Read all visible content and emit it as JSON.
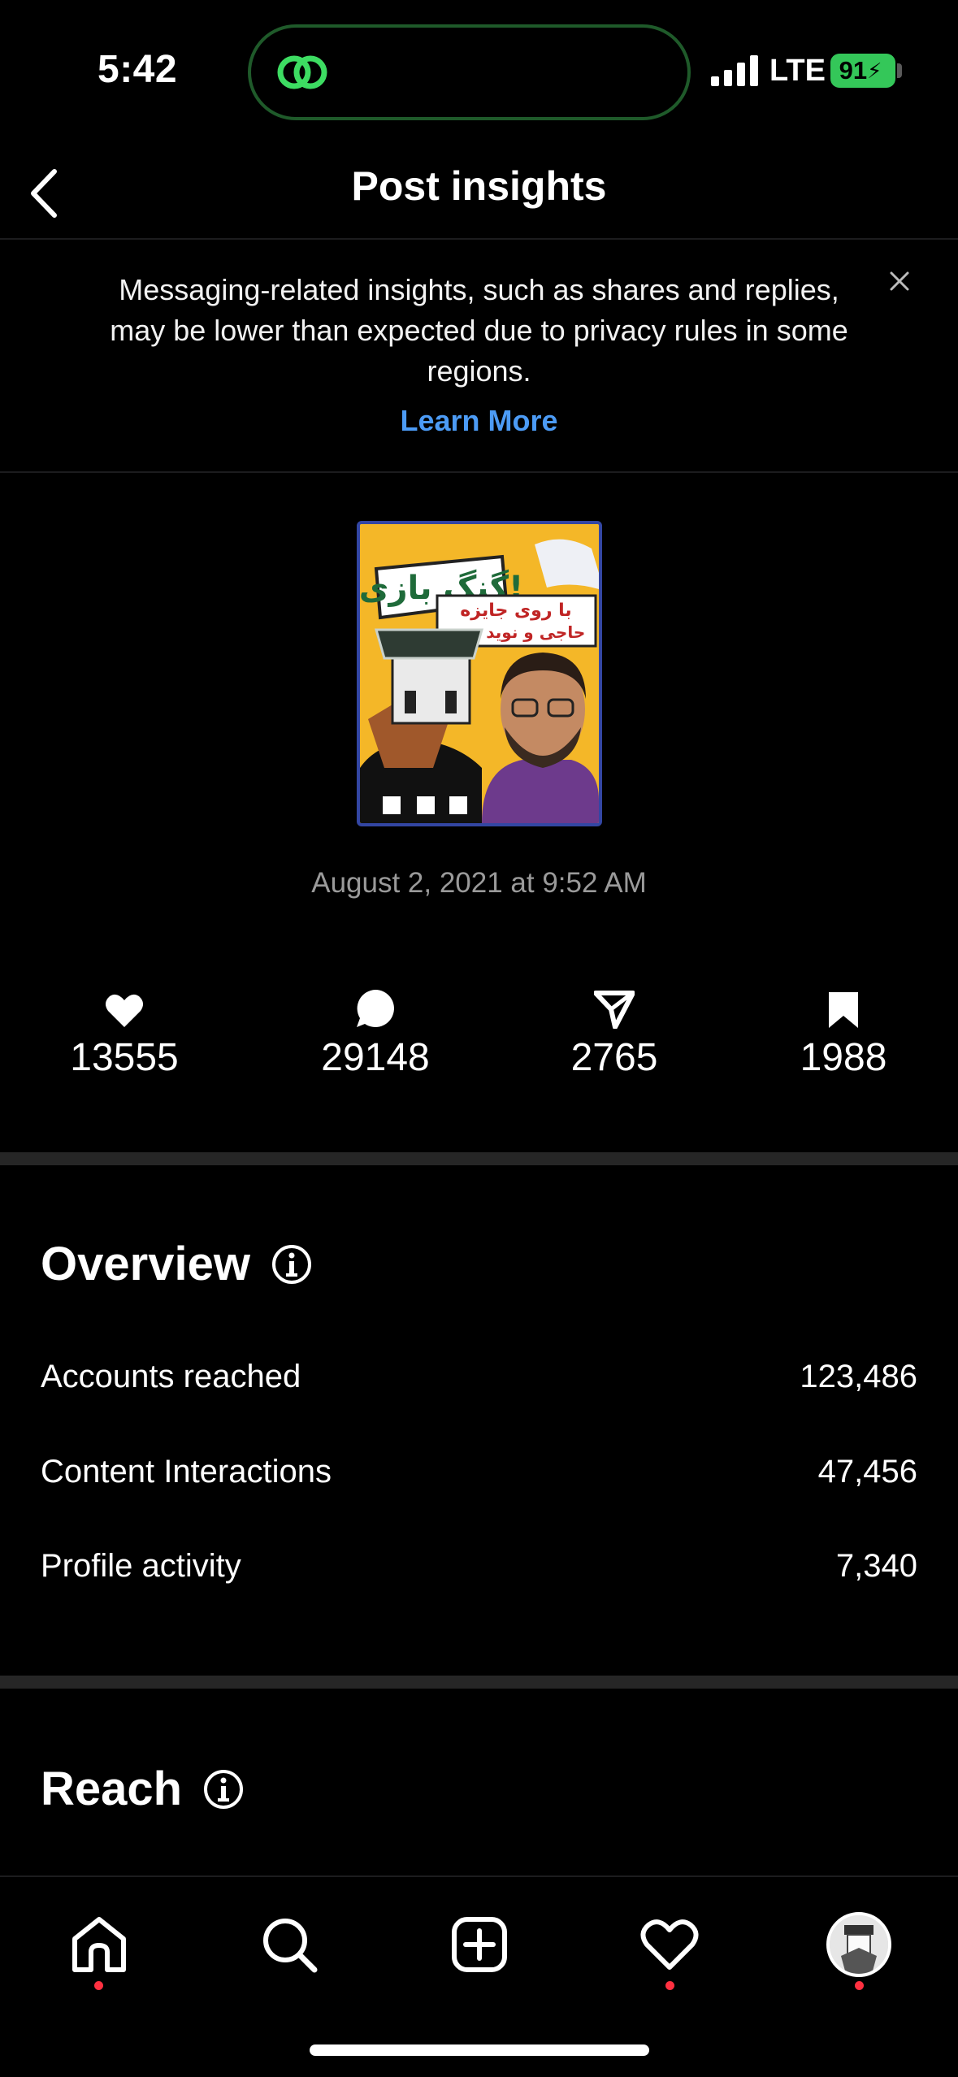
{
  "status_bar": {
    "time": "5:42",
    "network": "LTE",
    "battery": "91"
  },
  "header": {
    "title": "Post insights"
  },
  "notice": {
    "text": "Messaging-related insights, such as shares and replies, may be lower than expected due to privacy rules in some regions.",
    "link": "Learn More"
  },
  "post": {
    "date": "August 2, 2021 at 9:52 AM",
    "thumbnail_text": "گنگ بازی!",
    "thumbnail_subtext_1": "با روی جایزه",
    "thumbnail_subtext_2": "حاجی و نوید تیمز",
    "stats": [
      {
        "icon": "heart-icon",
        "value": "13555"
      },
      {
        "icon": "comment-icon",
        "value": "29148"
      },
      {
        "icon": "share-icon",
        "value": "2765"
      },
      {
        "icon": "save-icon",
        "value": "1988"
      }
    ]
  },
  "overview": {
    "title": "Overview",
    "metrics": [
      {
        "label": "Accounts reached",
        "value": "123,486"
      },
      {
        "label": "Content Interactions",
        "value": "47,456"
      },
      {
        "label": "Profile activity",
        "value": "7,340"
      }
    ]
  },
  "reach": {
    "title": "Reach"
  },
  "nav": {
    "items": [
      "home-icon",
      "search-icon",
      "create-icon",
      "activity-icon",
      "profile-avatar"
    ]
  },
  "colors": {
    "accent_link": "#4c9bf5",
    "notification_dot": "#ff3040",
    "battery": "#34c759"
  }
}
